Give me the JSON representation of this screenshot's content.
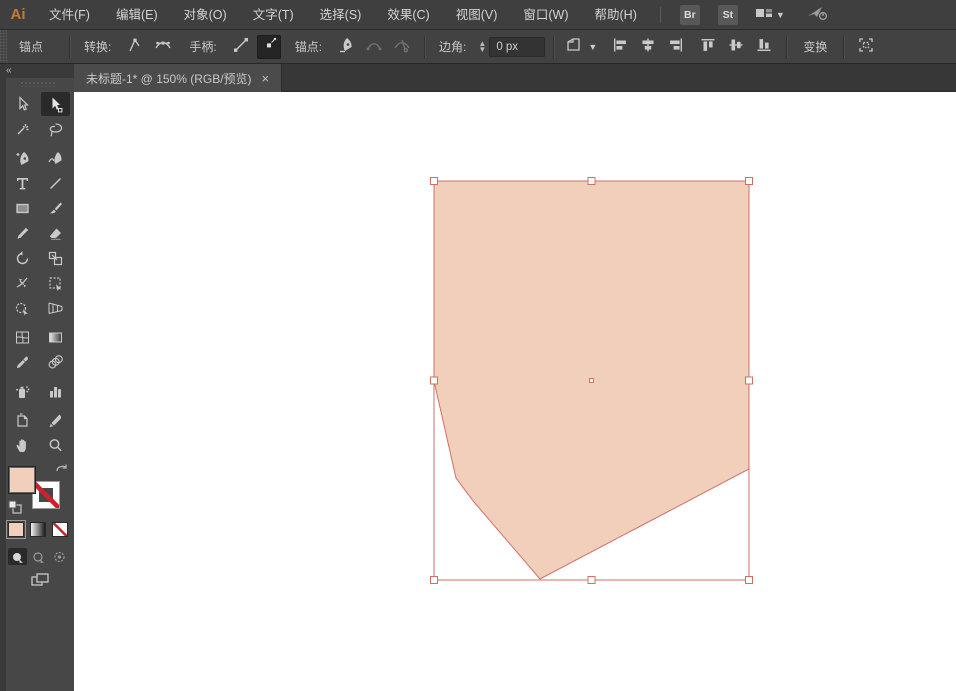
{
  "app": {
    "logo_text": "Ai",
    "logo_color": "#c77a35"
  },
  "menu_bar": {
    "items": [
      "文件(F)",
      "编辑(E)",
      "对象(O)",
      "文字(T)",
      "选择(S)",
      "效果(C)",
      "视图(V)",
      "窗口(W)",
      "帮助(H)"
    ],
    "bridge_button": "Br",
    "stock_button": "St",
    "icons": [
      "workspace-switcher-icon",
      "chevron-down-icon",
      "gpu-performance-icon"
    ]
  },
  "control_bar": {
    "context_label": "锚点",
    "convert_label": "转换:",
    "handles_label": "手柄:",
    "anchors_label": "锚点:",
    "corner_label": "边角:",
    "corner_value": "0 px",
    "transform_button": "变换",
    "icons": [
      "convert-to-corner-icon",
      "convert-to-smooth-icon",
      "show-handles-icon",
      "hide-handles-icon",
      "remove-anchor-icon",
      "connect-path-icon",
      "cut-path-icon",
      "artboard-options-icon",
      "align-left-icon",
      "align-h-center-icon",
      "align-right-icon",
      "align-top-icon",
      "align-v-center-icon",
      "align-bottom-icon",
      "isolate-selection-icon"
    ]
  },
  "tab_bar": {
    "collapse_glyph": "«",
    "active_tab_title": "未标题-1* @ 150% (RGB/预览)",
    "close_glyph": "×"
  },
  "toolbar": {
    "tools": [
      "selection",
      "direct-selection",
      "magic-wand",
      "lasso",
      "pen",
      "curvature",
      "type",
      "line-segment",
      "rectangle",
      "paintbrush",
      "pencil",
      "eraser",
      "rotate",
      "scale",
      "width",
      "free-transform",
      "shape-builder",
      "perspective-grid",
      "mesh",
      "gradient",
      "eyedropper",
      "blend",
      "symbol-sprayer",
      "column-graph",
      "artboard",
      "slice",
      "hand",
      "zoom"
    ],
    "selected_tool": "direct-selection",
    "drawing_modes": [
      "draw-normal",
      "draw-behind",
      "draw-inside"
    ],
    "selected_drawing_mode": "draw-normal"
  },
  "canvas": {
    "shape_fill": "#f2cfba",
    "selection_color": "#d06f68",
    "artboard_bg": "#ffffff"
  }
}
